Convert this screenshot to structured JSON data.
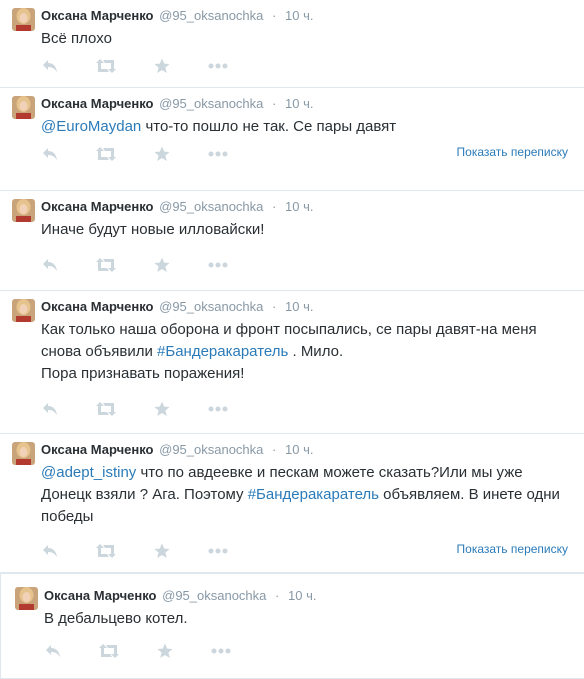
{
  "author": {
    "name": "Оксана Марченко",
    "handle": "@95_oksanochka",
    "separator": "·"
  },
  "tweets": [
    {
      "time": "10 ч.",
      "text_plain": "Всё плохо"
    },
    {
      "time": "10 ч.",
      "mention": "@EuroMaydan",
      "text_after": " что-то пошло не так. Се пары давят",
      "show_conversation": "Показать переписку"
    },
    {
      "time": "10 ч.",
      "text_plain": "Иначе будут новые илловайски!"
    },
    {
      "time": "10 ч.",
      "text_before": "Как только наша оборона и фронт посыпались, се пары давят-на меня снова объявили ",
      "hashtag": "#Бандеракаратель",
      "text_after": " . Мило.",
      "text_line3": "Пора признавать поражения!"
    },
    {
      "time": "10 ч.",
      "mention": "@adept_istiny",
      "text_middle": " что по авдеевке и пескам можете сказать?Или мы уже Донецк взяли ? Ага. Поэтому ",
      "hashtag": "#Бандеракаратель",
      "text_after": " объявляем. В инете одни победы",
      "show_conversation": "Показать переписку"
    },
    {
      "time": "10 ч.",
      "text_plain": "В дебальцево котел."
    }
  ],
  "icons": {
    "reply": "reply-icon",
    "retweet": "retweet-icon",
    "favorite": "star-icon",
    "more": "more-dots-icon"
  },
  "colors": {
    "link": "#2b7bb9",
    "muted": "#8899a6",
    "text": "#292f33",
    "icon": "#ccd6dd",
    "divider": "#e1e8ed"
  }
}
